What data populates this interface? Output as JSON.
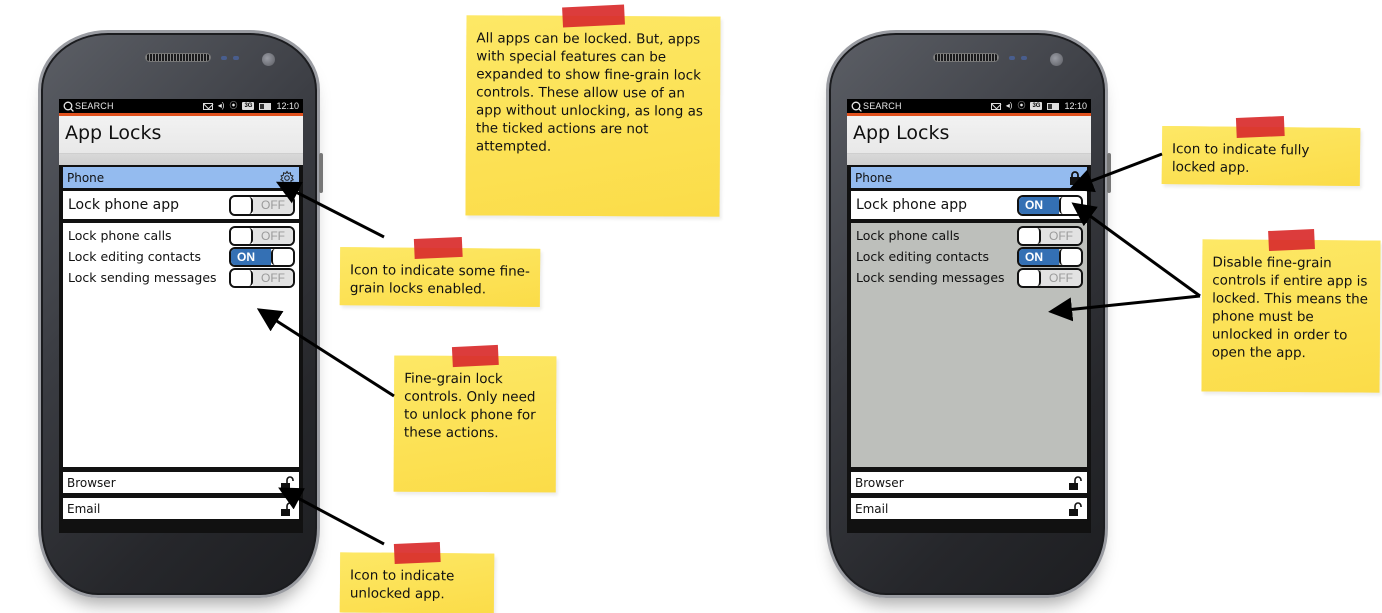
{
  "phones": [
    {
      "id": "expanded",
      "statusbar": {
        "search_label": "SEARCH",
        "time": "12:10",
        "network_badge": "3G",
        "icons": [
          "mail-icon",
          "volume-icon",
          "signal-icon",
          "3g-icon",
          "battery-icon"
        ]
      },
      "title": "App Locks",
      "apps": [
        {
          "name": "Phone",
          "icon": "gear-icon",
          "state": "partially-locked",
          "expanded": true
        },
        {
          "name": "Browser",
          "icon": "unlock-icon",
          "state": "unlocked"
        },
        {
          "name": "Email",
          "icon": "unlock-icon",
          "state": "unlocked"
        }
      ],
      "master": {
        "label": "Lock phone app",
        "on": false,
        "on_label": "ON",
        "off_label": "OFF"
      },
      "fine_grain_enabled": true,
      "fine_grain": [
        {
          "label": "Lock phone calls",
          "on": false
        },
        {
          "label": "Lock editing contacts",
          "on": true
        },
        {
          "label": "Lock sending messages",
          "on": false
        }
      ]
    },
    {
      "id": "locked",
      "statusbar": {
        "search_label": "SEARCH",
        "time": "12:10",
        "network_badge": "3G",
        "icons": [
          "mail-icon",
          "volume-icon",
          "signal-icon",
          "3g-icon",
          "battery-icon"
        ]
      },
      "title": "App Locks",
      "apps": [
        {
          "name": "Phone",
          "icon": "lock-icon",
          "state": "locked",
          "expanded": true
        },
        {
          "name": "Browser",
          "icon": "unlock-icon",
          "state": "unlocked"
        },
        {
          "name": "Email",
          "icon": "unlock-icon",
          "state": "unlocked"
        }
      ],
      "master": {
        "label": "Lock phone app",
        "on": true,
        "on_label": "ON",
        "off_label": "OFF"
      },
      "fine_grain_enabled": false,
      "fine_grain": [
        {
          "label": "Lock phone calls",
          "on": false
        },
        {
          "label": "Lock editing contacts",
          "on": true
        },
        {
          "label": "Lock sending messages",
          "on": false
        }
      ]
    }
  ],
  "toggle_labels": {
    "on": "ON",
    "off": "OFF"
  },
  "notes": {
    "intro": "All apps can be locked. But, apps with special features can be expanded to show fine-grain lock controls. These allow use of an app without unlocking, as long as the ticked actions are not attempted.",
    "gear": "Icon to indicate some fine-grain locks enabled.",
    "fine_grain": "Fine-grain lock controls. Only need to unlock phone for these actions.",
    "unlocked": "Icon to indicate unlocked app.",
    "fully_locked": "Icon to indicate fully locked app.",
    "disable": "Disable fine-grain controls if entire app is locked. This means the phone must be unlocked in order to open the app."
  },
  "colors": {
    "sticky": "#fde35a",
    "tape": "#d92b2b",
    "toggle_on": "#3470b4",
    "selected_row": "#94bbef",
    "disabled_panel": "#bdbfbb",
    "status_accent": "#e0511e"
  }
}
